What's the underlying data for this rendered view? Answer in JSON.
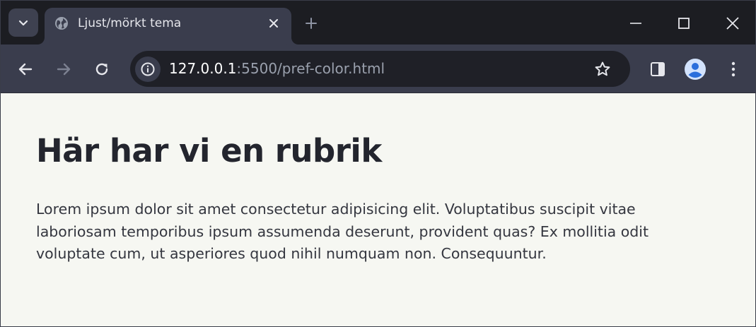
{
  "browser": {
    "tab": {
      "title": "Ljust/mörkt tema"
    },
    "address": {
      "host": "127.0.0.1",
      "rest": ":5500/pref-color.html"
    }
  },
  "page": {
    "heading": "Här har vi en rubrik",
    "paragraph": "Lorem ipsum dolor sit amet consectetur adipisicing elit. Voluptatibus suscipit vitae laboriosam temporibus ipsum assumenda deserunt, provident quas? Ex mollitia odit voluptate cum, ut asperiores quod nihil numquam non. Consequuntur."
  },
  "icons": {
    "tab_search": "chevron-down-icon",
    "favicon": "globe-icon",
    "tab_close": "close-icon",
    "new_tab": "plus-icon",
    "minimize": "minimize-icon",
    "maximize": "maximize-icon",
    "close_window": "close-icon",
    "back": "arrow-left-icon",
    "forward": "arrow-right-icon",
    "reload": "reload-icon",
    "site_info": "info-icon",
    "bookmark": "star-icon",
    "side_panel": "side-panel-icon",
    "profile": "profile-icon",
    "menu": "more-vertical-icon"
  },
  "colors": {
    "tabstrip": "#1c1d22",
    "toolbar": "#3a3d4d",
    "omnibox": "#1f2027",
    "page_background": "#f6f7f2",
    "heading_text": "#23252e",
    "profile_accent": "#2b6fdc"
  }
}
